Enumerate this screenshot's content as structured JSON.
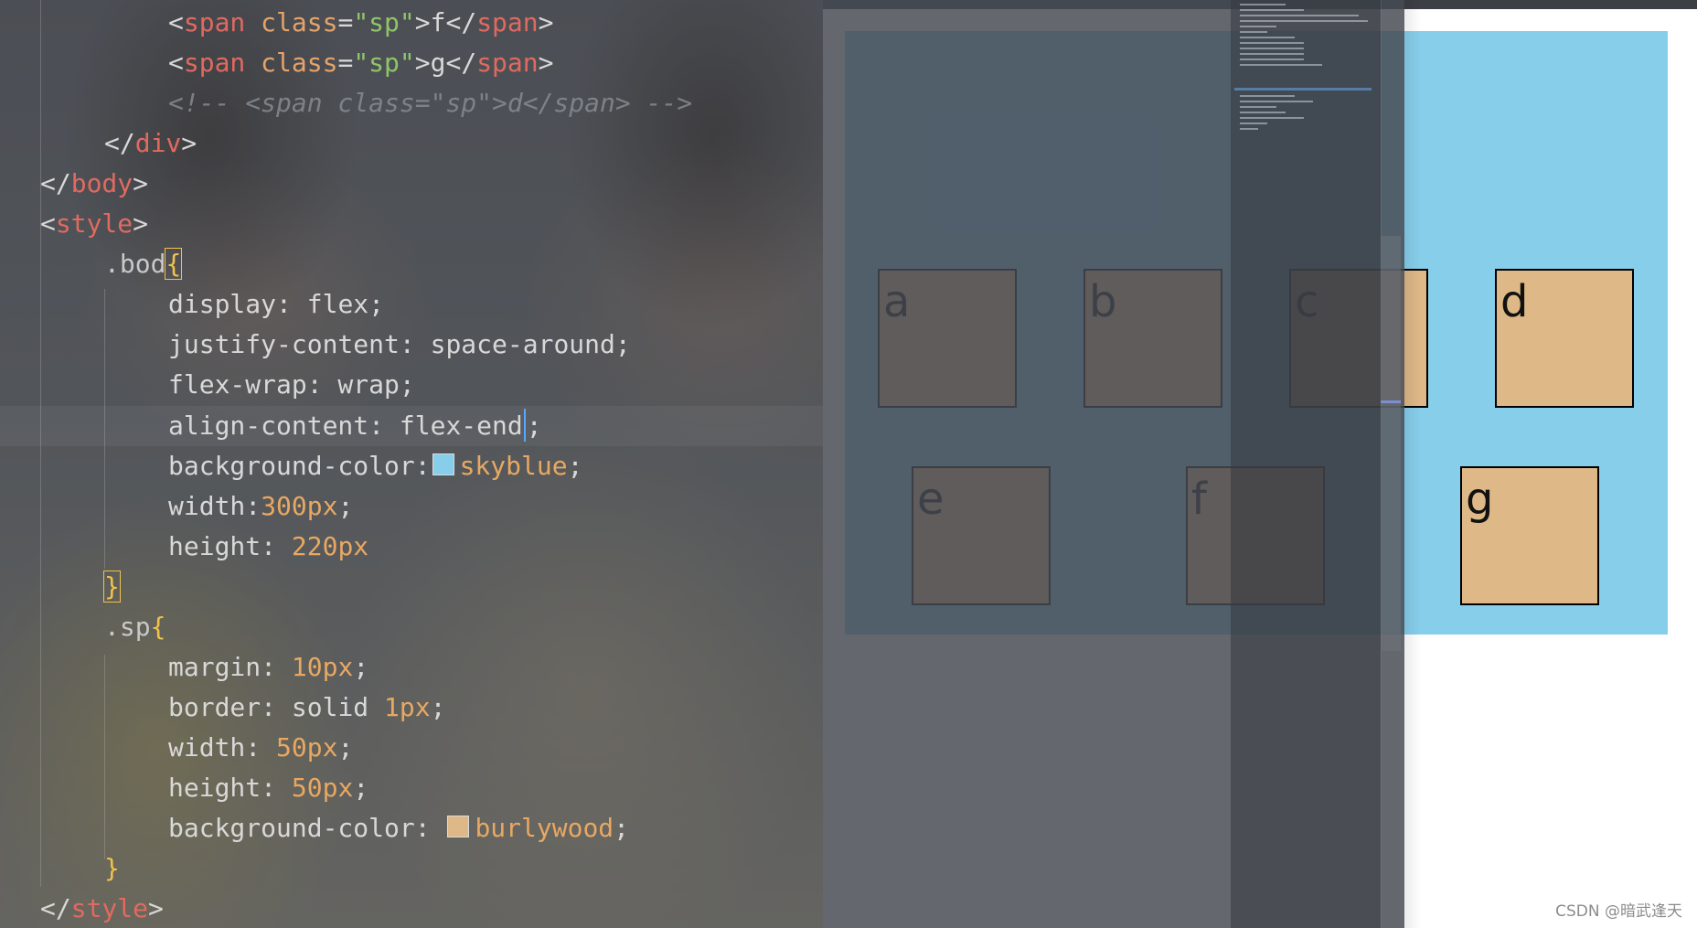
{
  "editor": {
    "lines": [
      {
        "indent": 3,
        "open": "<",
        "tag": "span",
        "attr": "class",
        "eq": "=",
        "str": "\"sp\"",
        "close": ">",
        "text": "f",
        "end_open": "</",
        "end_tag": "span",
        "end_close": ">"
      },
      {
        "indent": 3,
        "open": "<",
        "tag": "span",
        "attr": "class",
        "eq": "=",
        "str": "\"sp\"",
        "close": ">",
        "text": "g",
        "end_open": "</",
        "end_tag": "span",
        "end_close": ">"
      },
      {
        "comment": "<!-- <span class=\"sp\">d</span> -->"
      },
      {
        "open": "</",
        "tag": "div",
        "close": ">"
      },
      {
        "open": "</",
        "tag": "body",
        "close": ">"
      },
      {
        "open": "<",
        "tag": "style",
        "close": ">"
      },
      {
        "selector": ".bod",
        "brace": "{"
      },
      {
        "prop": "display",
        "colon": ":",
        "val": " flex",
        "semi": ";"
      },
      {
        "prop": "justify-content",
        "colon": ":",
        "val": " space-around",
        "semi": ";"
      },
      {
        "prop": "flex-wrap",
        "colon": ":",
        "val": " wrap",
        "semi": ";"
      },
      {
        "prop": "align-content",
        "colon": ":",
        "val": " flex-end",
        "semi": ";"
      },
      {
        "prop": "background-color",
        "colon": ":",
        "val": "skyblue",
        "semi": ";",
        "swatch": "#87ceeb"
      },
      {
        "prop": "width",
        "colon": ":",
        "val": "300px",
        "semi": ";"
      },
      {
        "prop": "height",
        "colon": ":",
        "val": " 220px"
      },
      {
        "brace": "}"
      },
      {
        "selector": ".sp",
        "brace": "{"
      },
      {
        "prop": "margin",
        "colon": ":",
        "val": " 10px",
        "semi": ";"
      },
      {
        "prop": "border",
        "colon": ":",
        "val": " solid ",
        "num": "1px",
        "semi": ";"
      },
      {
        "prop": "width",
        "colon": ":",
        "val": " 50px",
        "semi": ";"
      },
      {
        "prop": "height",
        "colon": ":",
        "val": " 50px",
        "semi": ";"
      },
      {
        "prop": "background-color",
        "colon": ":",
        "val": "burlywood",
        "semi": ";",
        "swatch": "#deb887"
      },
      {
        "brace": "}"
      },
      {
        "open": "</",
        "tag": "style",
        "close": ">"
      }
    ]
  },
  "preview": {
    "background_color": "#87ceeb",
    "box_color": "#deb887",
    "boxes": [
      "a",
      "b",
      "c",
      "d",
      "e",
      "f",
      "g"
    ]
  },
  "watermark": "CSDN @暗武逢天"
}
